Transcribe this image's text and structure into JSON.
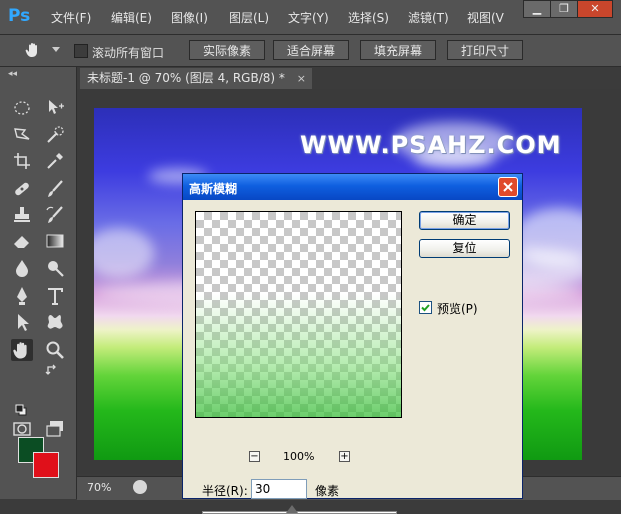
{
  "app": {
    "logo": "Ps",
    "menu": [
      "文件(F)",
      "编辑(E)",
      "图像(I)",
      "图层(L)",
      "文字(Y)",
      "选择(S)",
      "滤镜(T)",
      "视图(V"
    ]
  },
  "window_controls": {
    "minimize": "▁",
    "restore": "❐",
    "close": "✕"
  },
  "options_bar": {
    "scroll_all_label": "滚动所有窗口",
    "scroll_all_checked": false,
    "buttons": [
      "实际像素",
      "适合屏幕",
      "填充屏幕",
      "打印尺寸"
    ]
  },
  "tool_panel": {
    "collapse": "◂◂",
    "tools": [
      "marquee-icon",
      "move-icon",
      "lasso-icon",
      "quick-select-icon",
      "crop-icon",
      "eyedropper-icon",
      "healing-brush-icon",
      "brush-icon",
      "clone-stamp-icon",
      "history-brush-icon",
      "eraser-icon",
      "gradient-icon",
      "blur-icon",
      "dodge-icon",
      "pen-icon",
      "type-icon",
      "path-select-icon",
      "custom-shape-icon",
      "hand-icon",
      "zoom-icon",
      "quick-mask-icon",
      "screen-mode-icon"
    ],
    "active_tool": "hand-icon",
    "foreground_color": "#0b4d23",
    "background_color": "#e0101a"
  },
  "document": {
    "tab_title": "未标题-1 @ 70% (图层 4, RGB/8) *",
    "tab_close": "×",
    "watermark": "WWW.PSAHZ.COM"
  },
  "status_bar": {
    "zoom": "70%"
  },
  "dialog": {
    "title": "高斯模糊",
    "ok_label": "确定",
    "reset_label": "复位",
    "preview_label": "预览(P)",
    "preview_checked": true,
    "zoom_minus": "−",
    "zoom_level": "100%",
    "zoom_plus": "+",
    "radius_label": "半径(R):",
    "radius_value": "30",
    "radius_unit": "像素",
    "slider_fraction": 0.46
  },
  "colors": {
    "titlebar": "#0847c4",
    "close_button": "#e04a2c",
    "ui_panel": "#535353"
  }
}
